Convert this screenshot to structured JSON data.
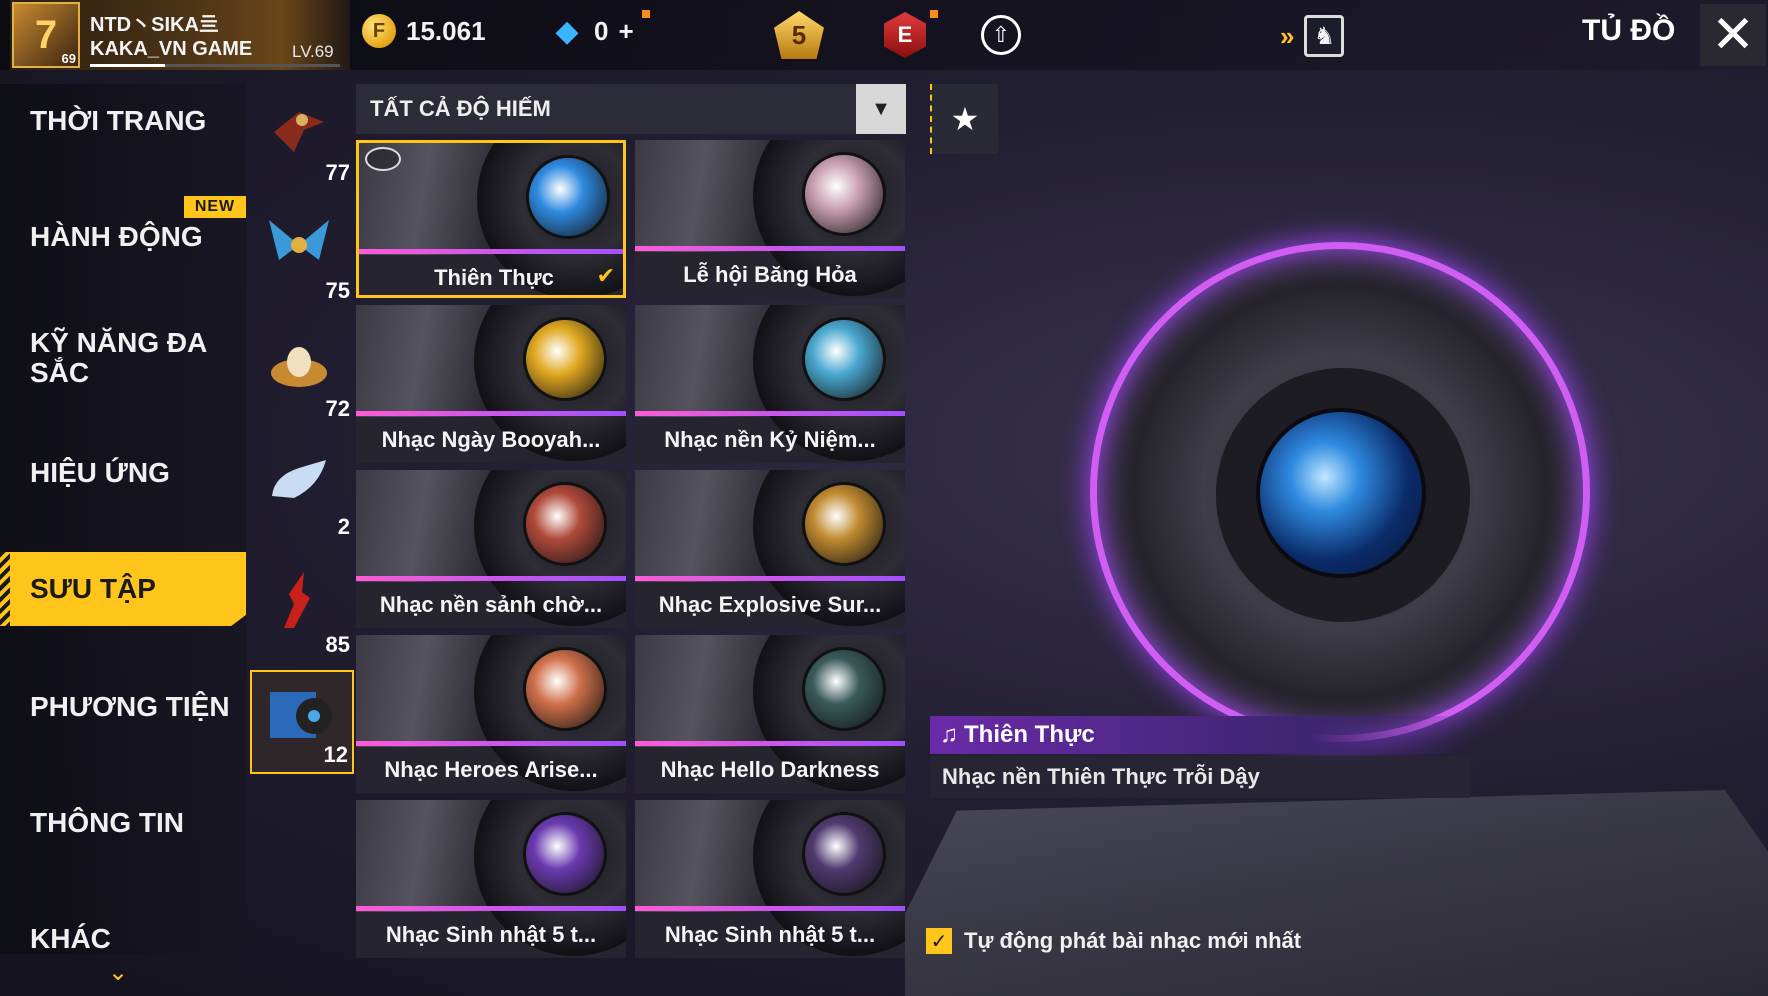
{
  "profile": {
    "name_line1": "NTD丶SIKA亖",
    "name_line2": "KAKA_VN GAME",
    "level_label": "LV.69",
    "avatar_level": "69",
    "avatar_glyph": "7"
  },
  "currency": {
    "gold": "15.061",
    "diamonds": "0",
    "diamonds_plus": "+",
    "coin_glyph": "F"
  },
  "top_icons": {
    "rank_value": "5",
    "e_badge": "E"
  },
  "header": {
    "title": "TỦ ĐỒ",
    "close_glyph": "✕"
  },
  "nav": {
    "items": [
      {
        "label": "THỜI TRANG"
      },
      {
        "label": "HÀNH ĐỘNG"
      },
      {
        "label": "KỸ NĂNG ĐA SẮC"
      },
      {
        "label": "HIỆU ỨNG"
      },
      {
        "label": "SƯU TẬP"
      },
      {
        "label": "PHƯƠNG TIỆN"
      },
      {
        "label": "THÔNG TIN"
      },
      {
        "label": "KHÁC"
      }
    ],
    "active_index": 4,
    "new_badge": "NEW"
  },
  "subcategories": [
    {
      "count": "77",
      "icon": "bird-emote-icon"
    },
    {
      "count": "75",
      "icon": "wings-icon"
    },
    {
      "count": "72",
      "icon": "nest-egg-icon"
    },
    {
      "count": "2",
      "icon": "cloud-feather-icon"
    },
    {
      "count": "85",
      "icon": "red-crystal-icon"
    },
    {
      "count": "12",
      "icon": "music-disc-icon"
    }
  ],
  "filter": {
    "label": "TẤT CẢ ĐỘ HIẾM"
  },
  "grid": {
    "items": [
      {
        "name": "Thiên Thực",
        "selected": true,
        "color": "#2f8ae0"
      },
      {
        "name": "Lễ hội Băng Hỏa",
        "selected": false,
        "color": "#c9a0b0"
      },
      {
        "name": "Nhạc Ngày Booyah...",
        "selected": false,
        "color": "#e0a820"
      },
      {
        "name": "Nhạc nền Kỷ Niệm...",
        "selected": false,
        "color": "#4aa8d0"
      },
      {
        "name": "Nhạc nền sảnh chờ...",
        "selected": false,
        "color": "#b04a3a"
      },
      {
        "name": "Nhạc Explosive Sur...",
        "selected": false,
        "color": "#c08a30"
      },
      {
        "name": "Nhạc Heroes Arise...",
        "selected": false,
        "color": "#d0704a"
      },
      {
        "name": "Nhạc Hello Darkness",
        "selected": false,
        "color": "#3a5a5a"
      },
      {
        "name": "Nhạc Sinh nhật 5 t...",
        "selected": false,
        "color": "#6a3ab0"
      },
      {
        "name": "Nhạc Sinh nhật 5 t...",
        "selected": false,
        "color": "#503a70"
      }
    ]
  },
  "preview": {
    "title": "Thiên Thực",
    "subtitle": "Nhạc nền Thiên Thực Trỗi Dậy",
    "ring_color": "#d05ef2"
  },
  "autoplay": {
    "label": "Tự động phát bài nhạc mới nhất",
    "checked": true
  },
  "colors": {
    "accent": "#ffc51a",
    "purple": "#a346ff"
  }
}
